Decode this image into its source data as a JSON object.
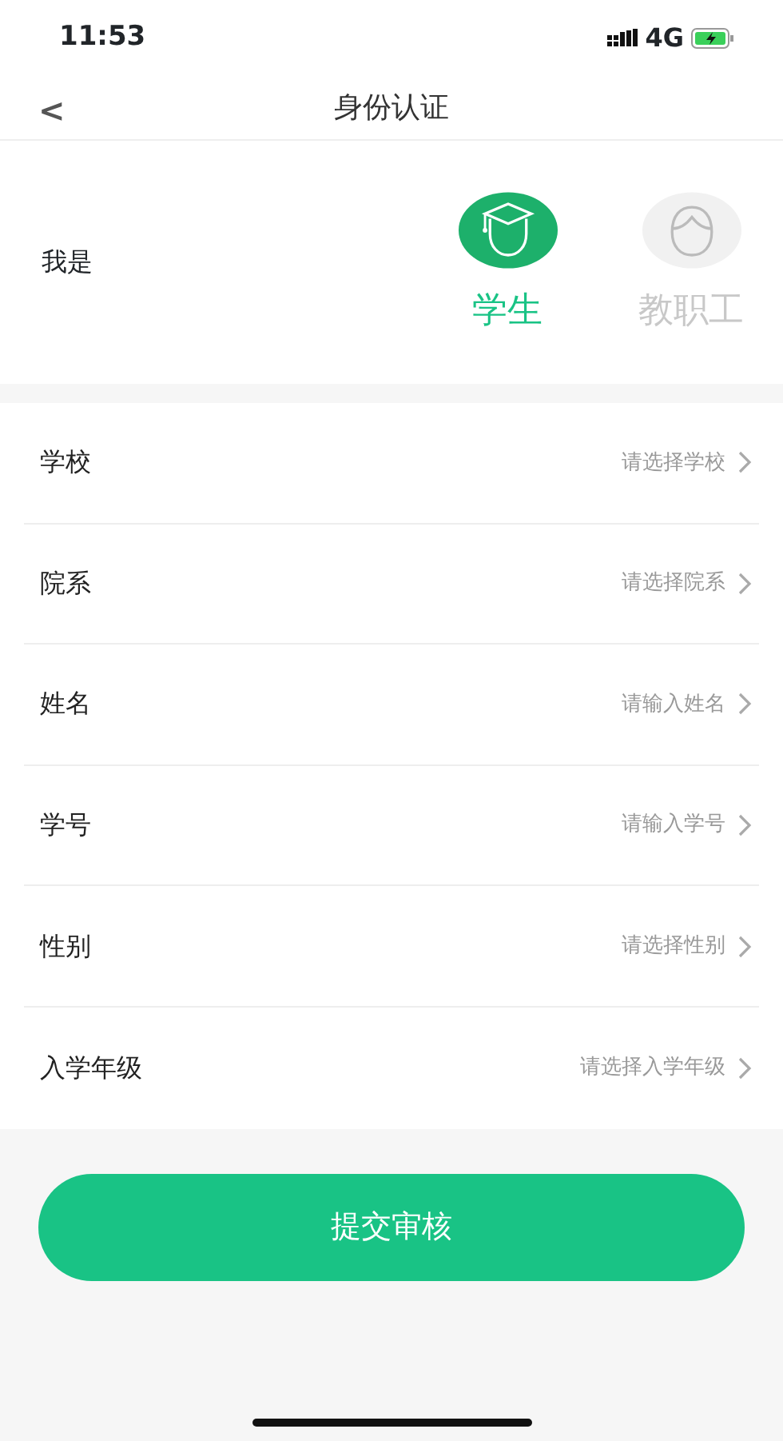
{
  "status_bar": {
    "time": "11:53",
    "network": "4G"
  },
  "nav": {
    "back": "<",
    "title": "身份认证"
  },
  "identity": {
    "label": "我是",
    "options": [
      {
        "kind": "student",
        "label": "学生",
        "selected": true
      },
      {
        "kind": "staff",
        "label": "教职工",
        "selected": false
      }
    ]
  },
  "fields": [
    {
      "label": "学校",
      "placeholder": "请选择学校"
    },
    {
      "label": "院系",
      "placeholder": "请选择院系"
    },
    {
      "label": "姓名",
      "placeholder": "请输入姓名"
    },
    {
      "label": "学号",
      "placeholder": "请输入学号"
    },
    {
      "label": "性别",
      "placeholder": "请选择性别"
    },
    {
      "label": "入学年级",
      "placeholder": "请选择入学年级"
    }
  ],
  "submit": "提交审核"
}
